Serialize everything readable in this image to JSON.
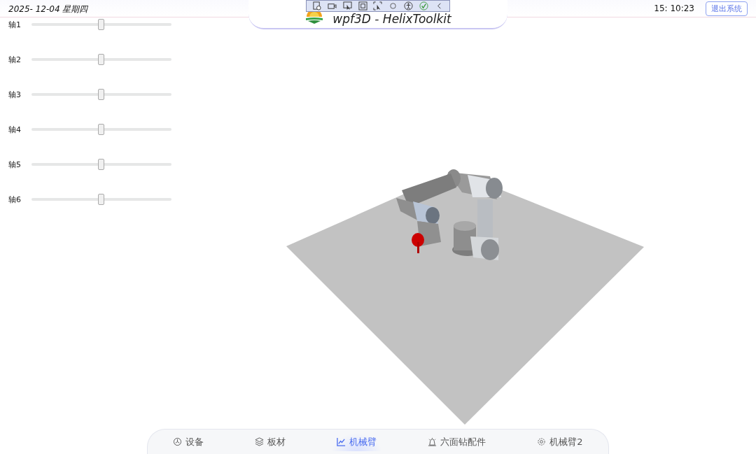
{
  "header": {
    "date": "2025- 12-04 星期四",
    "title": "wpf3D - HelixToolkit",
    "time": "15: 10:23",
    "exit_button": "退出系统"
  },
  "axes": [
    {
      "label": "轴1",
      "level": 0.5
    },
    {
      "label": "轴2",
      "level": 0.5
    },
    {
      "label": "轴3",
      "level": 0.5
    },
    {
      "label": "轴4",
      "level": 0.5
    },
    {
      "label": "轴5",
      "level": 0.5
    },
    {
      "label": "轴6",
      "level": 0.5
    }
  ],
  "nav": [
    {
      "label": "设备",
      "selected": false
    },
    {
      "label": "板材",
      "selected": false
    },
    {
      "label": "机械臂",
      "selected": true
    },
    {
      "label": "六面钻配件",
      "selected": false
    },
    {
      "label": "机械臂2",
      "selected": false
    }
  ]
}
